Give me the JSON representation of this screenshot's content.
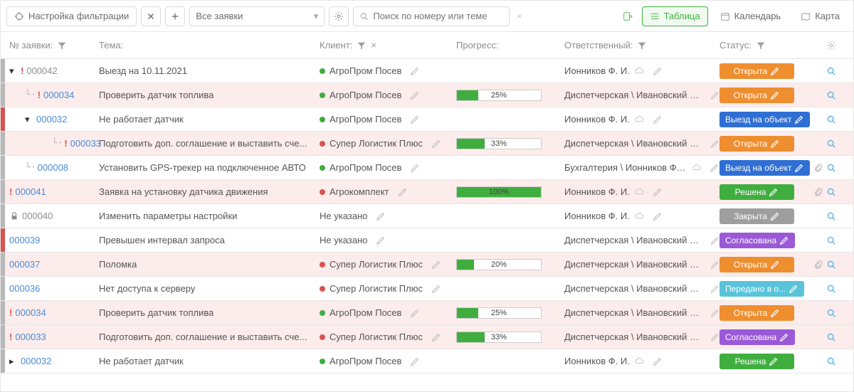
{
  "toolbar": {
    "filter_settings_label": "Настройка фильтрации",
    "filter_select_value": "Все заявки",
    "search_placeholder": "Поиск по номеру или теме",
    "views": {
      "table": "Таблица",
      "calendar": "Календарь",
      "map": "Карта"
    }
  },
  "columns": {
    "id": "№ заявки:",
    "topic": "Тема:",
    "client": "Клиент:",
    "progress": "Прогресс:",
    "responsible": "Ответственный:",
    "status": "Статус:"
  },
  "statuses": {
    "open": "Открыта",
    "onsite": "Выезд на объект",
    "solved": "Решена",
    "closed": "Закрыта",
    "approved": "Согласована",
    "forwarded": "Передано в о..."
  },
  "rows": [
    {
      "stripe": "#b8b8b8",
      "level": 0,
      "expander": "down",
      "prio": true,
      "lock": false,
      "id_text": "000042",
      "id_style": "gray",
      "topic": "Выезд на 10.11.2021",
      "client_dot": "green",
      "client": "АгроПром Посев",
      "progress": null,
      "resp": "Ионников Ф. И.",
      "resp_icon": "cloud",
      "status": "open",
      "status_class": "b-orange",
      "bg": "",
      "attach": false
    },
    {
      "stripe": "#b8b8b8",
      "level": 1,
      "expander": null,
      "prio": true,
      "lock": false,
      "id_text": "000034",
      "id_style": "blue",
      "topic": "Проверить датчик топлива",
      "client_dot": "green",
      "client": "АгроПром Посев",
      "progress": 25,
      "resp": "Диспетчерская \\ Ивановский С. Ф.",
      "resp_icon": null,
      "status": "open",
      "status_class": "b-orange",
      "bg": "pink",
      "attach": false,
      "tree_pre": "└·"
    },
    {
      "stripe": "#d9534f",
      "level": 1,
      "expander": "down",
      "prio": false,
      "lock": false,
      "id_text": "000032",
      "id_style": "blue",
      "topic": "Не работает датчик",
      "client_dot": "green",
      "client": "АгроПром Посев",
      "progress": null,
      "resp": "Ионников Ф. И.",
      "resp_icon": "cloud",
      "status": "onsite",
      "status_class": "b-blue",
      "bg": "",
      "attach": false,
      "tree_pre": ""
    },
    {
      "stripe": "#b8b8b8",
      "level": 2,
      "expander": null,
      "prio": true,
      "lock": false,
      "id_text": "000033",
      "id_style": "blue",
      "topic": "Подготовить доп. соглашение и выставить сче...",
      "client_dot": "red",
      "client": "Супер Логистик Плюс",
      "progress": 33,
      "resp": "Диспетчерская \\ Ивановский С. Ф.",
      "resp_icon": null,
      "status": "open",
      "status_class": "b-orange",
      "bg": "pink",
      "attach": false,
      "tree_pre": "  └·"
    },
    {
      "stripe": "#b8b8b8",
      "level": 1,
      "expander": null,
      "prio": false,
      "lock": false,
      "id_text": "000008",
      "id_style": "blue",
      "topic": "Установить GPS-трекер на подключенное АВТО",
      "client_dot": "green",
      "client": "АгроПром Посев",
      "progress": null,
      "resp": "Бухгалтерия \\ Ионников Ф. И.",
      "resp_icon": "cloud",
      "status": "onsite",
      "status_class": "b-blue",
      "bg": "",
      "attach": true,
      "tree_pre": "└·"
    },
    {
      "stripe": "#b8b8b8",
      "level": 0,
      "expander": null,
      "prio": true,
      "lock": false,
      "id_text": "000041",
      "id_style": "blue",
      "topic": "Заявка на установку датчика движения",
      "client_dot": "red",
      "client": "Агрокомплект",
      "progress": 100,
      "resp": "Ионников Ф. И.",
      "resp_icon": "cloud",
      "status": "solved",
      "status_class": "b-green",
      "bg": "pink",
      "attach": true
    },
    {
      "stripe": "#b8b8b8",
      "level": 0,
      "expander": null,
      "prio": false,
      "lock": true,
      "id_text": "000040",
      "id_style": "gray",
      "topic": "Изменить параметры настройки",
      "client_dot": null,
      "client": "Не указано",
      "progress": null,
      "resp": "Ионников Ф. И.",
      "resp_icon": "cloud",
      "status": "closed",
      "status_class": "b-gray",
      "bg": "",
      "attach": false
    },
    {
      "stripe": "#d9534f",
      "level": 0,
      "expander": null,
      "prio": false,
      "lock": false,
      "id_text": "000039",
      "id_style": "blue",
      "topic": "Превышен интервал запроса",
      "client_dot": null,
      "client": "Не указано",
      "progress": null,
      "resp": "Диспетчерская \\ Ивановский С. Ф.",
      "resp_icon": null,
      "status": "approved",
      "status_class": "b-violet",
      "bg": "",
      "attach": false
    },
    {
      "stripe": "#b8b8b8",
      "level": 0,
      "expander": null,
      "prio": false,
      "lock": false,
      "id_text": "000037",
      "id_style": "blue",
      "topic": "Поломка",
      "client_dot": "red",
      "client": "Супер Логистик Плюс",
      "progress": 20,
      "resp": "Диспетчерская \\ Ивановский С. Ф.",
      "resp_icon": null,
      "status": "open",
      "status_class": "b-orange",
      "bg": "pink",
      "attach": true
    },
    {
      "stripe": "#b8b8b8",
      "level": 0,
      "expander": null,
      "prio": false,
      "lock": false,
      "id_text": "000036",
      "id_style": "blue",
      "topic": "Нет доступа к серверу",
      "client_dot": "red",
      "client": "Супер Логистик Плюс",
      "progress": null,
      "resp": "Диспетчерская \\ Ивановский С. Ф.",
      "resp_icon": null,
      "status": "forwarded",
      "status_class": "b-teal",
      "bg": "",
      "attach": false
    },
    {
      "stripe": "#b8b8b8",
      "level": 0,
      "expander": null,
      "prio": true,
      "lock": false,
      "id_text": "000034",
      "id_style": "blue",
      "topic": "Проверить датчик топлива",
      "client_dot": "green",
      "client": "АгроПром Посев",
      "progress": 25,
      "resp": "Диспетчерская \\ Ивановский С. Ф.",
      "resp_icon": null,
      "status": "open",
      "status_class": "b-orange",
      "bg": "pink",
      "attach": false
    },
    {
      "stripe": "#b8b8b8",
      "level": 0,
      "expander": null,
      "prio": true,
      "lock": false,
      "id_text": "000033",
      "id_style": "blue",
      "topic": "Подготовить доп. соглашение и выставить сче...",
      "client_dot": "red",
      "client": "Супер Логистик Плюс",
      "progress": 33,
      "resp": "Диспетчерская \\ Ивановский С. Ф.",
      "resp_icon": null,
      "status": "approved",
      "status_class": "b-violet",
      "bg": "pink",
      "attach": false
    },
    {
      "stripe": "#b8b8b8",
      "level": 0,
      "expander": "right",
      "prio": false,
      "lock": false,
      "id_text": "000032",
      "id_style": "blue",
      "topic": "Не работает датчик",
      "client_dot": "green",
      "client": "АгроПром Посев",
      "progress": null,
      "resp": "Ионников Ф. И.",
      "resp_icon": "cloud",
      "status": "solved",
      "status_class": "b-green",
      "bg": "",
      "attach": false
    }
  ]
}
